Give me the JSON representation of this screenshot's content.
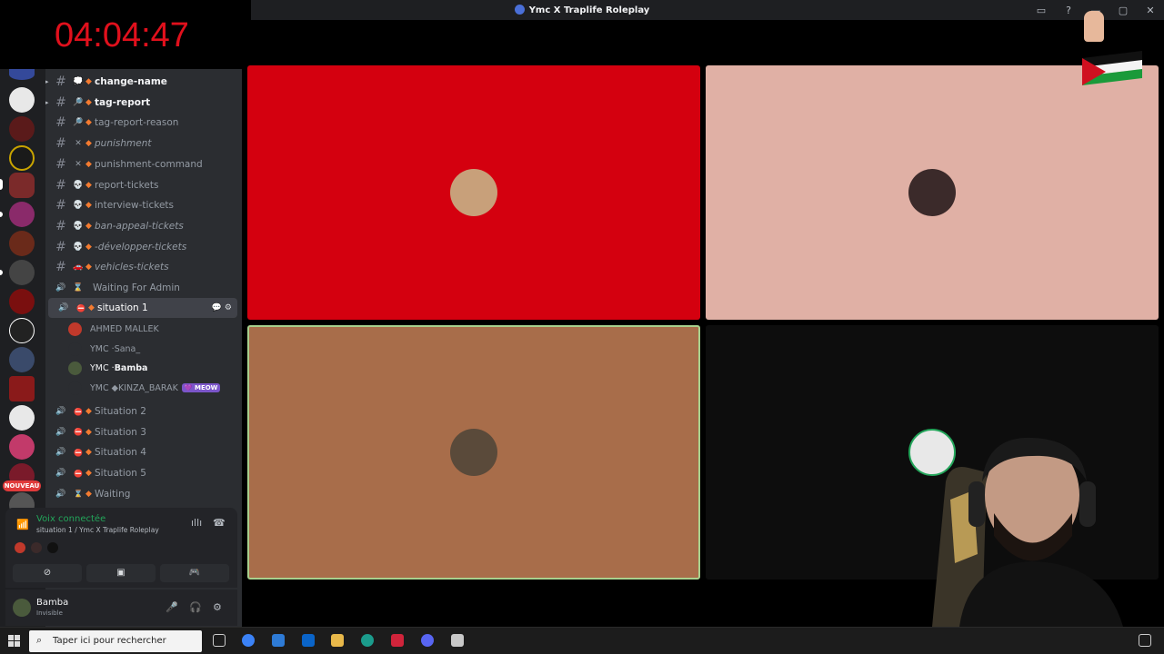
{
  "window": {
    "title": "Ymc X Traplife Roleplay",
    "controls": [
      "▭",
      "?",
      "—",
      "▢",
      "✕"
    ]
  },
  "overlay": {
    "timer": "04:04:47"
  },
  "guilds": {
    "badge": "NOUVEAU"
  },
  "channels": [
    {
      "icon": "💭",
      "name": "change-name",
      "style": "bold",
      "arrow": true,
      "diamond": true
    },
    {
      "icon": "🔎",
      "name": "tag-report",
      "style": "bold",
      "arrow": true,
      "diamond": true
    },
    {
      "icon": "🔎",
      "name": "tag-report-reason",
      "style": "",
      "arrow": false,
      "diamond": true
    },
    {
      "icon": "✕",
      "name": "punishment",
      "style": "ital",
      "arrow": false,
      "diamond": true
    },
    {
      "icon": "✕",
      "name": "punishment-command",
      "style": "",
      "arrow": false,
      "diamond": true
    },
    {
      "icon": "💀",
      "name": "report-tickets",
      "style": "",
      "arrow": false,
      "diamond": true
    },
    {
      "icon": "💀",
      "name": "interview-tickets",
      "style": "",
      "arrow": false,
      "diamond": true
    },
    {
      "icon": "💀",
      "name": "ban-appeal-tickets",
      "style": "ital",
      "arrow": false,
      "diamond": true
    },
    {
      "icon": "💀",
      "name": "-développer-tickets",
      "style": "ital",
      "arrow": false,
      "diamond": true
    },
    {
      "icon": "🚗",
      "name": "vehicles-tickets",
      "style": "ital",
      "arrow": false,
      "diamond": true
    },
    {
      "icon": "⌛",
      "name": "Waiting For Admin",
      "style": "voice",
      "arrow": false,
      "diamond": false
    }
  ],
  "active_channel": {
    "name": "situation 1"
  },
  "voice_users": [
    {
      "prefix": "",
      "name": "AHMED MALLEK",
      "color": "#c0392b"
    },
    {
      "prefix": "YMC · ",
      "name": "Sana_",
      "color": "#2b2d31"
    },
    {
      "prefix": "YMC · ",
      "name": "Bamba",
      "color": "#4a5a3c"
    },
    {
      "prefix": "YMC ◆ ",
      "name": "KINZA_BARAK",
      "color": "#2b2d31",
      "tag": "💜 MEOW"
    }
  ],
  "voice_channels": [
    {
      "name": "Situation 2"
    },
    {
      "name": "Situation 3"
    },
    {
      "name": "Situation 4"
    },
    {
      "name": "Situation 5"
    },
    {
      "name": "Waiting",
      "icon": "⌛"
    }
  ],
  "voice_panel": {
    "status": "Voix connectée",
    "location": "situation 1 / Ymc X Traplife Roleplay"
  },
  "user": {
    "name": "Bamba",
    "status": "Invisible"
  },
  "tiles": [
    {
      "color": "#d4000f",
      "avatar": "#c8a07a"
    },
    {
      "color": "#e0b0a5",
      "avatar": "#3b2a2a"
    },
    {
      "color": "#a86d4a",
      "avatar": "#5a4a3a"
    },
    {
      "color": "#0d0d0d",
      "avatar": "#e8e8e8"
    }
  ],
  "taskbar": {
    "search_placeholder": "Taper ici pour rechercher"
  }
}
